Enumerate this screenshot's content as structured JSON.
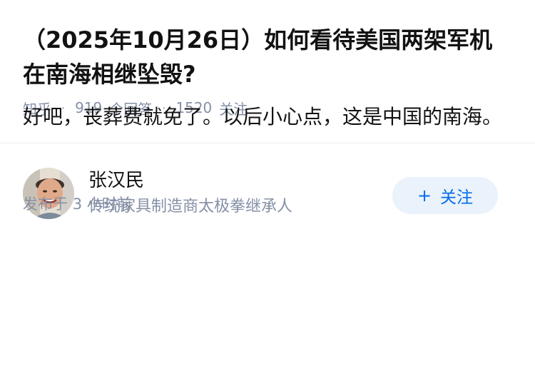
{
  "question": {
    "title": "（2025年10月26日）如何看待美国两架军机在南海相继坠毁?",
    "source": "知乎",
    "answer_count": "919",
    "answer_label": "个回答",
    "follower_count": "1520",
    "follower_label": "关注"
  },
  "answer": {
    "author_name": "张汉民",
    "author_bio": "传统家具制造商太极拳继承人",
    "follow_button_label": "关注",
    "follow_button_icon": "plus-icon",
    "content": "好吧，丧葬费就免了。以后小心点，这是中国的南海。",
    "published_label": "发布于",
    "published_time": "3 小时前"
  },
  "colors": {
    "accent": "#056de8",
    "follow_bg": "#eaf2fb",
    "meta_text": "#8590a6",
    "primary_text": "#121212"
  }
}
